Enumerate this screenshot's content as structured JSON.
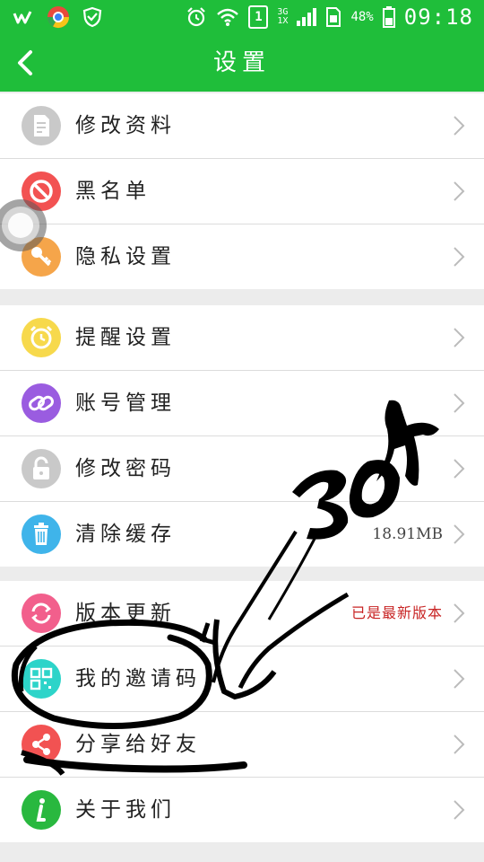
{
  "status_bar": {
    "left_icons": [
      "weibo-icon",
      "chrome-icon",
      "shield-icon"
    ],
    "alarm_icon": "alarm-icon",
    "wifi_icon": "wifi-icon",
    "sim_slot": "1",
    "network_top": "3G",
    "network_bottom": "1X",
    "battery_percent": "48%",
    "time": "09:18"
  },
  "header": {
    "title": "设置",
    "back_icon": "chevron-left-icon"
  },
  "groups": [
    {
      "items": [
        {
          "label": "修改资料",
          "icon": "document-edit-icon",
          "color": "#c9c9c9"
        },
        {
          "label": "黑名单",
          "icon": "block-icon",
          "color": "#f25252"
        },
        {
          "label": "隐私设置",
          "icon": "key-icon",
          "color": "#f5a54a"
        }
      ]
    },
    {
      "items": [
        {
          "label": "提醒设置",
          "icon": "alarm-clock-icon",
          "color": "#f7d94c"
        },
        {
          "label": "账号管理",
          "icon": "link-icon",
          "color": "#9a5ce0"
        },
        {
          "label": "修改密码",
          "icon": "lock-icon",
          "color": "#c9c9c9"
        },
        {
          "label": "清除缓存",
          "icon": "trash-icon",
          "color": "#3fb4ea",
          "value": "18.91MB"
        }
      ]
    },
    {
      "items": [
        {
          "label": "版本更新",
          "icon": "refresh-icon",
          "color": "#f25f8c",
          "value": "已是最新版本"
        },
        {
          "label": "我的邀请码",
          "icon": "qr-code-icon",
          "color": "#2dd4c9"
        },
        {
          "label": "分享给好友",
          "icon": "share-icon",
          "color": "#f25252"
        },
        {
          "label": "关于我们",
          "icon": "info-icon",
          "color": "#29b83f"
        }
      ]
    }
  ],
  "annotation": {
    "handwritten_text": "30万"
  },
  "colors": {
    "header_bg": "#1fbe3a",
    "page_bg": "#ececec",
    "divider": "#dcdcdc",
    "value_red": "#c82424"
  }
}
